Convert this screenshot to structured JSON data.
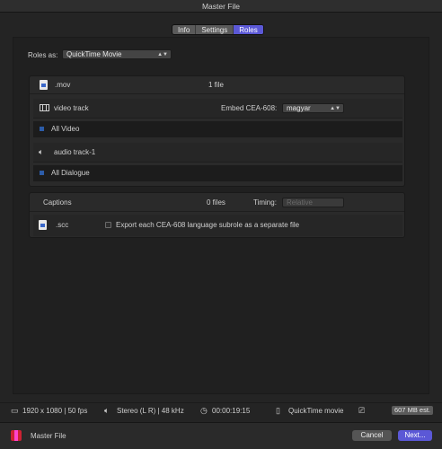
{
  "window": {
    "title": "Master File"
  },
  "tabs": [
    {
      "label": "Info",
      "active": false
    },
    {
      "label": "Settings",
      "active": false
    },
    {
      "label": "Roles",
      "active": true
    }
  ],
  "roles_as": {
    "label": "Roles as:",
    "value": "QuickTime Movie"
  },
  "main_group": {
    "mov": {
      "ext": ".mov",
      "count": "1 file"
    },
    "video_track": {
      "label": "video track",
      "embed_label": "Embed CEA-608:",
      "embed_value": "magyar",
      "role": "All Video"
    },
    "audio_track": {
      "label": "audio track-1",
      "role": "All Dialogue"
    }
  },
  "captions_group": {
    "label": "Captions",
    "count": "0 files",
    "timing_label": "Timing:",
    "timing_value": "Relative",
    "scc": {
      "ext": ".scc",
      "checkbox_label": "Export each CEA-608 language subrole as a separate file",
      "checked": false
    }
  },
  "status_bar": {
    "resolution": "1920 x 1080 | 50 fps",
    "audio": "Stereo (L R) | 48 kHz",
    "duration": "00:00:19:15",
    "format": "QuickTime movie",
    "estimate": "607 MB est."
  },
  "footer": {
    "name": "Master File",
    "cancel_label": "Cancel",
    "next_label": "Next..."
  },
  "colors": {
    "accent": "#5b58d6",
    "role_swatch": "#2c5ca8"
  }
}
